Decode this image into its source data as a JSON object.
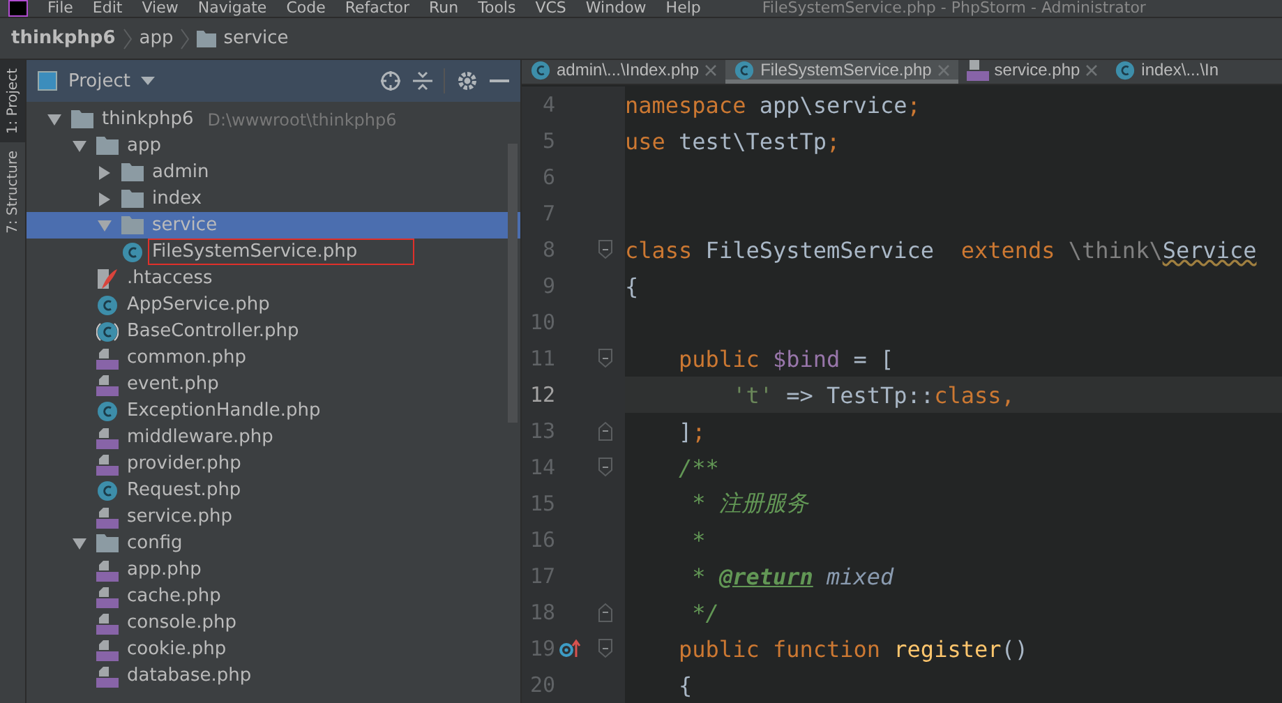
{
  "menu_bar": {
    "items": [
      "File",
      "Edit",
      "View",
      "Navigate",
      "Code",
      "Refactor",
      "Run",
      "Tools",
      "VCS",
      "Window",
      "Help"
    ],
    "title": "FileSystemService.php - PhpStorm - Administrator"
  },
  "breadcrumb": [
    {
      "label": "thinkphp6",
      "kind": "project"
    },
    {
      "label": "app",
      "kind": "dir"
    },
    {
      "label": "service",
      "kind": "folder"
    }
  ],
  "side_tool_tabs": [
    {
      "label": "1: Project",
      "selected": true
    },
    {
      "label": "7: Structure",
      "selected": false
    }
  ],
  "project_panel": {
    "title": "Project",
    "tree": [
      {
        "label": "thinkphp6",
        "path": "D:\\wwwroot\\thinkphp6",
        "kind": "folder",
        "expanded": true,
        "selected": false,
        "outlined": false,
        "children": [
          {
            "label": "app",
            "kind": "folder",
            "expanded": true,
            "selected": false,
            "outlined": false,
            "children": [
              {
                "label": "admin",
                "kind": "folder",
                "expanded": false,
                "selected": false,
                "outlined": false
              },
              {
                "label": "index",
                "kind": "folder",
                "expanded": false,
                "selected": false,
                "outlined": false
              },
              {
                "label": "service",
                "kind": "folder",
                "expanded": true,
                "selected": true,
                "outlined": false,
                "children": [
                  {
                    "label": "FileSystemService.php",
                    "kind": "class",
                    "selected": false,
                    "outlined": true
                  }
                ]
              },
              {
                "label": ".htaccess",
                "kind": "htaccess",
                "selected": false,
                "outlined": false
              },
              {
                "label": "AppService.php",
                "kind": "class",
                "selected": false,
                "outlined": false
              },
              {
                "label": "BaseController.php",
                "kind": "abstract",
                "selected": false,
                "outlined": false
              },
              {
                "label": "common.php",
                "kind": "php",
                "selected": false,
                "outlined": false
              },
              {
                "label": "event.php",
                "kind": "php",
                "selected": false,
                "outlined": false
              },
              {
                "label": "ExceptionHandle.php",
                "kind": "class",
                "selected": false,
                "outlined": false
              },
              {
                "label": "middleware.php",
                "kind": "php",
                "selected": false,
                "outlined": false
              },
              {
                "label": "provider.php",
                "kind": "php",
                "selected": false,
                "outlined": false
              },
              {
                "label": "Request.php",
                "kind": "class",
                "selected": false,
                "outlined": false
              },
              {
                "label": "service.php",
                "kind": "php",
                "selected": false,
                "outlined": false
              }
            ]
          },
          {
            "label": "config",
            "kind": "folder",
            "expanded": true,
            "selected": false,
            "outlined": false,
            "children": [
              {
                "label": "app.php",
                "kind": "php",
                "selected": false,
                "outlined": false
              },
              {
                "label": "cache.php",
                "kind": "php",
                "selected": false,
                "outlined": false
              },
              {
                "label": "console.php",
                "kind": "php",
                "selected": false,
                "outlined": false
              },
              {
                "label": "cookie.php",
                "kind": "php",
                "selected": false,
                "outlined": false
              },
              {
                "label": "database.php",
                "kind": "php",
                "selected": false,
                "outlined": false
              }
            ]
          }
        ]
      }
    ]
  },
  "editor_tabs": [
    {
      "label": "admin\\...\\Index.php",
      "kind": "class",
      "selected": false
    },
    {
      "label": "FileSystemService.php",
      "kind": "class",
      "selected": true
    },
    {
      "label": "service.php",
      "kind": "php",
      "selected": false
    },
    {
      "label": "index\\...\\In",
      "kind": "class",
      "selected": false
    }
  ],
  "code_lines": [
    {
      "number": "4",
      "current": false,
      "kind": "plain",
      "tokens": [
        {
          "text": "namespace",
          "kind": "keyword"
        },
        {
          "text": " app\\service",
          "kind": "plain"
        },
        {
          "text": ";",
          "kind": "keyword"
        }
      ]
    },
    {
      "number": "5",
      "current": false,
      "kind": "plain",
      "tokens": [
        {
          "text": "use",
          "kind": "keyword"
        },
        {
          "text": " test\\TestTp",
          "kind": "plain"
        },
        {
          "text": ";",
          "kind": "keyword"
        }
      ]
    },
    {
      "number": "6",
      "current": false,
      "kind": "plain"
    },
    {
      "number": "7",
      "current": false,
      "kind": "plain"
    },
    {
      "number": "8",
      "current": false,
      "kind": "opener",
      "tokens": [
        {
          "text": "class",
          "kind": "keyword"
        },
        {
          "text": " FileSystemService  ",
          "kind": "plain"
        },
        {
          "text": "extends",
          "kind": "keyword"
        },
        {
          "text": " \\think\\",
          "kind": "dim"
        },
        {
          "text": "Service",
          "kind": "warning"
        }
      ]
    },
    {
      "number": "9",
      "current": false,
      "kind": "plain",
      "tokens": [
        {
          "text": "{",
          "kind": "plain"
        }
      ]
    },
    {
      "number": "10",
      "current": false,
      "kind": "plain"
    },
    {
      "number": "11",
      "current": false,
      "kind": "opener",
      "tokens": [
        {
          "text": "    public",
          "kind": "keyword"
        },
        {
          "text": " $bind",
          "kind": "variable"
        },
        {
          "text": " = [",
          "kind": "plain"
        }
      ]
    },
    {
      "number": "12",
      "current": true,
      "kind": "plain",
      "tokens": [
        {
          "text": "        't'",
          "kind": "string"
        },
        {
          "text": " => TestTp::",
          "kind": "plain"
        },
        {
          "text": "class,",
          "kind": "keyword"
        }
      ]
    },
    {
      "number": "13",
      "current": false,
      "kind": "closer",
      "tokens": [
        {
          "text": "    ]",
          "kind": "plain"
        },
        {
          "text": ";",
          "kind": "keyword"
        }
      ]
    },
    {
      "number": "14",
      "current": false,
      "kind": "opener",
      "tokens": [
        {
          "text": "    /**",
          "kind": "doc"
        }
      ]
    },
    {
      "number": "15",
      "current": false,
      "kind": "plain",
      "tokens": [
        {
          "text": "     * 注册服务",
          "kind": "doc"
        }
      ]
    },
    {
      "number": "16",
      "current": false,
      "kind": "plain",
      "tokens": [
        {
          "text": "     *",
          "kind": "doc"
        }
      ]
    },
    {
      "number": "17",
      "current": false,
      "kind": "plain",
      "tokens": [
        {
          "text": "     * ",
          "kind": "doc"
        },
        {
          "text": "@return",
          "kind": "doc-tag"
        },
        {
          "text": " mixed",
          "kind": "doc-type"
        }
      ]
    },
    {
      "number": "18",
      "current": false,
      "kind": "closer",
      "tokens": [
        {
          "text": "     */",
          "kind": "doc"
        }
      ]
    },
    {
      "number": "19",
      "current": false,
      "kind": "method",
      "tokens": [
        {
          "text": "    public function",
          "kind": "keyword"
        },
        {
          "text": " register",
          "kind": "function"
        },
        {
          "text": "()",
          "kind": "plain"
        }
      ]
    },
    {
      "number": "20",
      "current": false,
      "kind": "plain",
      "tokens": [
        {
          "text": "    {",
          "kind": "plain"
        }
      ]
    }
  ]
}
